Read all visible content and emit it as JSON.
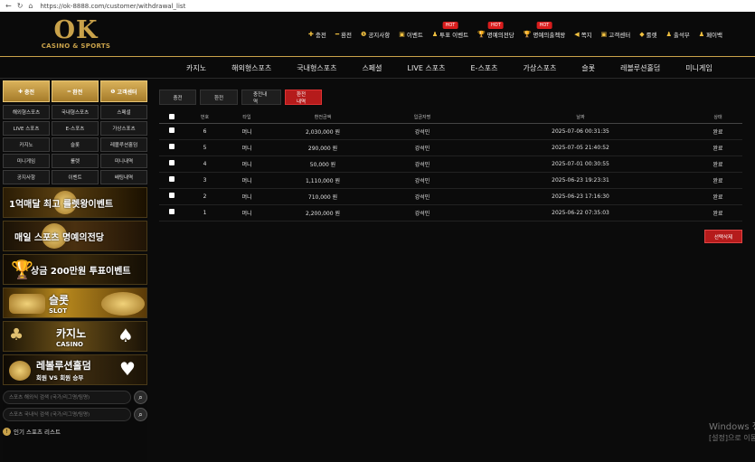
{
  "browser": {
    "url": "https://ok-8888.com/customer/withdrawal_list"
  },
  "logo": {
    "main": "OK",
    "sub": "CASINO & SPORTS"
  },
  "top_links": [
    {
      "icon": "✚",
      "label": "충전",
      "hot": ""
    },
    {
      "icon": "━",
      "label": "환전",
      "hot": ""
    },
    {
      "icon": "❶",
      "label": "공지사항",
      "hot": ""
    },
    {
      "icon": "▣",
      "label": "이벤트",
      "hot": ""
    },
    {
      "icon": "♟",
      "label": "투표 이벤트",
      "hot": "HOT"
    },
    {
      "icon": "🏆",
      "label": "명예의전당",
      "hot": "HOT"
    },
    {
      "icon": "🏆",
      "label": "명예의출첵왕",
      "hot": "HOT"
    },
    {
      "icon": "◀",
      "label": "쪽지",
      "hot": ""
    },
    {
      "icon": "▣",
      "label": "고객센터",
      "hot": ""
    },
    {
      "icon": "◆",
      "label": "룰렛",
      "hot": ""
    },
    {
      "icon": "♟",
      "label": "출석부",
      "hot": ""
    },
    {
      "icon": "♟",
      "label": "페이백",
      "hot": ""
    }
  ],
  "main_nav": [
    "카지노",
    "해외형스포츠",
    "국내형스포츠",
    "스페셜",
    "LIVE 스포츠",
    "E-스포츠",
    "가상스포츠",
    "슬롯",
    "레볼루션홀덤",
    "미니게임"
  ],
  "quick_buttons": [
    {
      "icon": "✚",
      "label": "충전"
    },
    {
      "icon": "━",
      "label": "환전"
    },
    {
      "icon": "❶",
      "label": "고객센터"
    }
  ],
  "categories": [
    "해외형스포츠",
    "국내형스포츠",
    "스페셜",
    "LIVE 스포츠",
    "E-스포츠",
    "가상스포츠",
    "카지노",
    "슬롯",
    "레볼루션홀덤",
    "미니게임",
    "룰렛",
    "미니내역",
    "공지사항",
    "이벤트",
    "배팅내역"
  ],
  "banners": {
    "b1": "1억매달 최고 룰렛왕이벤트",
    "b2": "매일 스포츠 명예의전당",
    "b3": "상금 200만원 투표이벤트",
    "b4_title": "슬롯",
    "b4_sub": "SLOT",
    "b5_title": "카지노",
    "b5_sub": "CASINO",
    "b6_title": "레볼루션홀덤",
    "b6_sub": "회원 VS 회원 승부"
  },
  "search": {
    "placeholder1": "스포츠 해외식 검색 (국가/리그명/팀명)",
    "placeholder2": "스포츠 국내식 검색 (국가/리그명/팀명)"
  },
  "popular_label": "인기 스포츠 리스트",
  "tabs": [
    "충전",
    "환전",
    "충전내역",
    "환전내역"
  ],
  "active_tab": "환전내역",
  "table": {
    "headers": [
      "번호",
      "타입",
      "환전금액",
      "입금자명",
      "날짜",
      "상태"
    ],
    "rows": [
      {
        "no": "6",
        "type": "머니",
        "amount": "2,030,000 원",
        "name": "강석민",
        "date": "2025-07-06 00:31:35",
        "status": "완료"
      },
      {
        "no": "5",
        "type": "머니",
        "amount": "290,000 원",
        "name": "강석민",
        "date": "2025-07-05 21:40:52",
        "status": "완료"
      },
      {
        "no": "4",
        "type": "머니",
        "amount": "50,000 원",
        "name": "강석민",
        "date": "2025-07-01 00:30:55",
        "status": "완료"
      },
      {
        "no": "3",
        "type": "머니",
        "amount": "1,110,000 원",
        "name": "강석민",
        "date": "2025-06-23 19:23:31",
        "status": "완료"
      },
      {
        "no": "2",
        "type": "머니",
        "amount": "710,000 원",
        "name": "강석민",
        "date": "2025-06-23 17:16:30",
        "status": "완료"
      },
      {
        "no": "1",
        "type": "머니",
        "amount": "2,200,000 원",
        "name": "강석민",
        "date": "2025-06-22 07:35:03",
        "status": "완료"
      }
    ]
  },
  "delete_button": "선택삭제",
  "watermark": {
    "line1": "Windows 정",
    "line2": "[설정]으로 이동"
  }
}
